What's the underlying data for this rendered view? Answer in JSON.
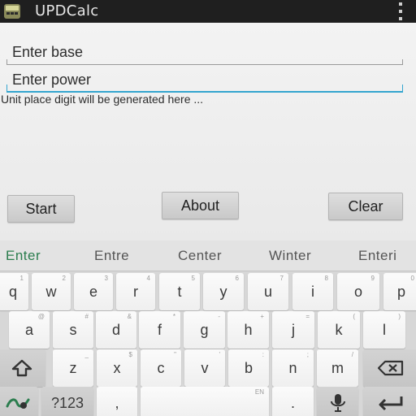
{
  "app": {
    "title": "UPDCalc"
  },
  "form": {
    "base_placeholder": "Enter base",
    "power_placeholder": "Enter power",
    "result_text": "Unit place digit will be generated here ..."
  },
  "buttons": {
    "start": "Start",
    "about": "About",
    "clear": "Clear"
  },
  "keyboard": {
    "suggestions": [
      "Enter",
      "Entre",
      "Center",
      "Winter",
      "Enteri"
    ],
    "row1": [
      {
        "label": "q",
        "hint": "1"
      },
      {
        "label": "w",
        "hint": "2"
      },
      {
        "label": "e",
        "hint": "3"
      },
      {
        "label": "r",
        "hint": "4"
      },
      {
        "label": "t",
        "hint": "5"
      },
      {
        "label": "y",
        "hint": "6"
      },
      {
        "label": "u",
        "hint": "7"
      },
      {
        "label": "i",
        "hint": "8"
      },
      {
        "label": "o",
        "hint": "9"
      },
      {
        "label": "p",
        "hint": "0"
      }
    ],
    "row2": [
      {
        "label": "a",
        "hint": "@"
      },
      {
        "label": "s",
        "hint": "#"
      },
      {
        "label": "d",
        "hint": "&"
      },
      {
        "label": "f",
        "hint": "*"
      },
      {
        "label": "g",
        "hint": "-"
      },
      {
        "label": "h",
        "hint": "+"
      },
      {
        "label": "j",
        "hint": "="
      },
      {
        "label": "k",
        "hint": "("
      },
      {
        "label": "l",
        "hint": ")"
      }
    ],
    "row3": [
      {
        "label": "z",
        "hint": "_"
      },
      {
        "label": "x",
        "hint": "$"
      },
      {
        "label": "c",
        "hint": "\""
      },
      {
        "label": "v",
        "hint": "'"
      },
      {
        "label": "b",
        "hint": ":"
      },
      {
        "label": "n",
        "hint": ";"
      },
      {
        "label": "m",
        "hint": "/"
      }
    ],
    "symbols_label": "?123",
    "comma_label": ",",
    "space_hint": "EN",
    "period_label": ".",
    "icons": {
      "shift": "shift-icon",
      "delete": "backspace-icon",
      "swype": "swype-icon",
      "mic": "microphone-icon",
      "enter": "enter-icon"
    }
  },
  "colors": {
    "accent": "#33a5cf",
    "suggestion_selected": "#2b7d4e",
    "titlebar": "#1f1f1f"
  }
}
